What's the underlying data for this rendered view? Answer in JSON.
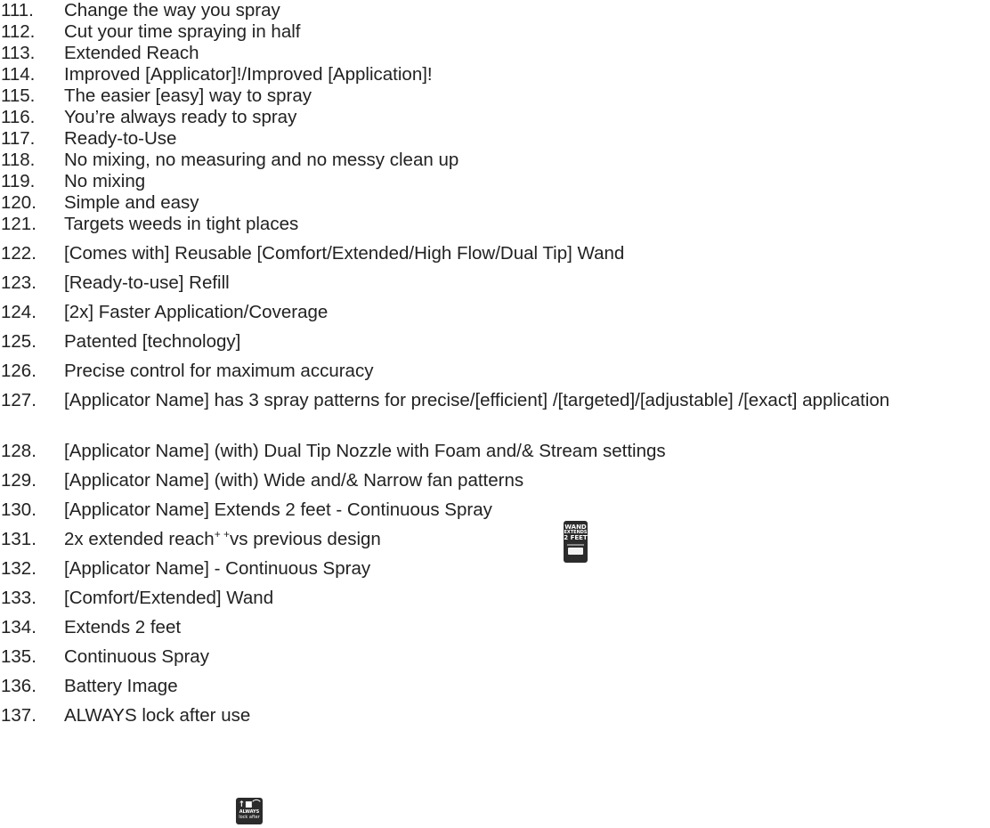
{
  "items": [
    {
      "num": "111.",
      "text": "Change the way you spray"
    },
    {
      "num": "112.",
      "text": "Cut your time spraying in half"
    },
    {
      "num": "113.",
      "text": "Extended Reach"
    },
    {
      "num": "114.",
      "text": "Improved [Applicator]!/Improved [Application]!"
    },
    {
      "num": "115.",
      "text": "The easier [easy] way to spray"
    },
    {
      "num": "116.",
      "text": "You’re always ready to spray"
    },
    {
      "num": "117.",
      "text": "Ready-to-Use"
    },
    {
      "num": "118.",
      "text": "No mixing, no measuring and no messy clean up"
    },
    {
      "num": "119.",
      "text": "No mixing"
    },
    {
      "num": "120.",
      "text": "Simple and easy"
    },
    {
      "num": "121.",
      "text": "Targets weeds in tight places"
    },
    {
      "num": "122.",
      "text": "[Comes with] Reusable [Comfort/Extended/High Flow/Dual Tip] Wand"
    },
    {
      "num": "123.",
      "text": "[Ready-to-use] Refill"
    },
    {
      "num": "124.",
      "text": "[2x] Faster Application/Coverage"
    },
    {
      "num": "125.",
      "text": "Patented [technology]"
    },
    {
      "num": "126.",
      "text": "Precise control for maximum accuracy"
    },
    {
      "num": "127.",
      "text": "[Applicator Name] has 3 spray patterns for precise/[efficient] /[targeted]/[adjustable] /[exact] application"
    },
    {
      "num": "128.",
      "text": "[Applicator Name] (with) Dual Tip Nozzle with Foam and/& Stream settings"
    },
    {
      "num": "129.",
      "text": "[Applicator Name] (with) Wide and/& Narrow fan patterns"
    },
    {
      "num": "130.",
      "text": "[Applicator Name] Extends 2 feet - Continuous Spray"
    },
    {
      "num": "131.",
      "text_before": "2x extended reach",
      "sup": "+ +",
      "text_after": "vs previous design"
    },
    {
      "num": "132.",
      "text": "[Applicator Name] - Continuous Spray"
    },
    {
      "num": "133.",
      "text": "[Comfort/Extended] Wand"
    },
    {
      "num": "134.",
      "text": "Extends 2 feet"
    },
    {
      "num": "135.",
      "text": "Continuous Spray"
    },
    {
      "num": "136.",
      "text": "Battery Image"
    },
    {
      "num": "137.",
      "text": "ALWAYS lock after use"
    }
  ],
  "badges": {
    "wand": {
      "line1": "WAND",
      "line2": "EXTENDS",
      "line3": "2 FEET"
    },
    "lock": {
      "glyph": "↑■⌒",
      "line1": "ALWAYS",
      "line2": "lock after"
    }
  }
}
